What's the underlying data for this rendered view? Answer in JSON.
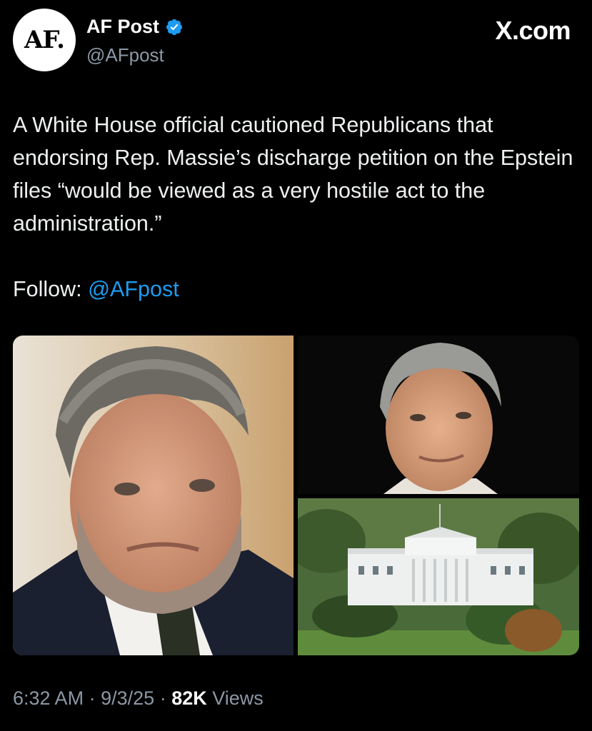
{
  "header": {
    "avatar_text": "AF.",
    "display_name": "AF Post",
    "handle": "@AFpost",
    "brand": "X.com",
    "verified_icon": "verified-badge-icon",
    "verified_color": "#1d9bf0"
  },
  "tweet": {
    "text": "A White House official cautioned Republicans that endorsing Rep. Massie’s discharge petition on the Epstein files “would be viewed as a very hostile act to the administration.”",
    "follow_label": "Follow:",
    "follow_mention": "@AFpost"
  },
  "media": {
    "images": [
      "man-with-beard-photo",
      "man-smiling-photo",
      "white-house-aerial-photo"
    ]
  },
  "meta": {
    "time": "6:32 AM",
    "separator": "·",
    "date": "9/3/25",
    "views_count": "82K",
    "views_label": "Views"
  },
  "colors": {
    "background": "#000000",
    "text": "#e7e9ea",
    "secondary": "#8b98a5",
    "link": "#1d9bf0"
  }
}
